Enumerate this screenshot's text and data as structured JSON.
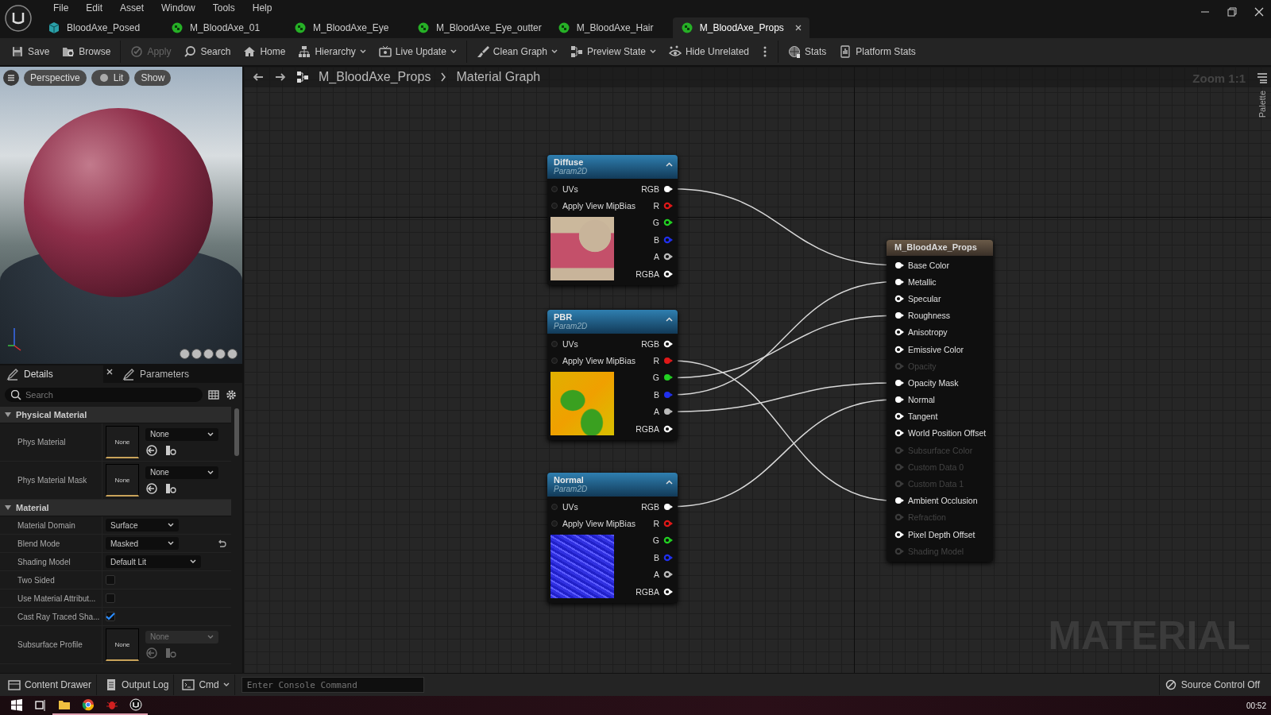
{
  "menu": [
    "File",
    "Edit",
    "Asset",
    "Window",
    "Tools",
    "Help"
  ],
  "tabs": [
    {
      "label": "BloodAxe_Posed",
      "kind": "mesh",
      "selected": false
    },
    {
      "label": "M_BloodAxe_01",
      "kind": "material",
      "selected": false
    },
    {
      "label": "M_BloodAxe_Eye",
      "kind": "material",
      "selected": false
    },
    {
      "label": "M_BloodAxe_Eye_outter",
      "kind": "material",
      "selected": false
    },
    {
      "label": "M_BloodAxe_Hair",
      "kind": "material",
      "selected": false
    },
    {
      "label": "M_BloodAxe_Props",
      "kind": "material",
      "selected": true
    }
  ],
  "toolbar": [
    {
      "label": "Save",
      "disabled": false,
      "dropdown": false,
      "separated": false
    },
    {
      "label": "Browse",
      "disabled": false,
      "dropdown": false,
      "separated": false
    },
    {
      "label": "Apply",
      "disabled": true,
      "dropdown": false,
      "separated": true
    },
    {
      "label": "Search",
      "disabled": false,
      "dropdown": false,
      "separated": false
    },
    {
      "label": "Home",
      "disabled": false,
      "dropdown": false,
      "separated": false
    },
    {
      "label": "Hierarchy",
      "disabled": false,
      "dropdown": true,
      "separated": false
    },
    {
      "label": "Live Update",
      "disabled": false,
      "dropdown": true,
      "separated": false
    },
    {
      "label": "Clean Graph",
      "disabled": false,
      "dropdown": true,
      "separated": true
    },
    {
      "label": "Preview State",
      "disabled": false,
      "dropdown": true,
      "separated": false
    },
    {
      "label": "Hide Unrelated",
      "disabled": false,
      "dropdown": false,
      "separated": false
    },
    {
      "disabled": false,
      "dropdown": false,
      "separated": false
    },
    {
      "label": "Stats",
      "disabled": false,
      "dropdown": false,
      "separated": true
    },
    {
      "label": "Platform Stats",
      "disabled": false,
      "dropdown": false,
      "separated": false
    }
  ],
  "viewport": {
    "buttons": [
      {
        "label": "Perspective",
        "kind": "plain"
      },
      {
        "label": "Lit",
        "kind": "lit"
      },
      {
        "label": "Show",
        "kind": "plain"
      }
    ]
  },
  "details": {
    "tabs": [
      {
        "label": "Details",
        "selected": true
      },
      {
        "label": "Parameters",
        "selected": false
      }
    ],
    "search": {
      "placeholder": "Search"
    },
    "sections": [
      {
        "title": "Physical Material",
        "expanded": true,
        "rows": [
          {
            "label": "Phys Material",
            "kind": "asset",
            "thumb": "None",
            "value": "None",
            "disabled": false
          },
          {
            "label": "Phys Material Mask",
            "kind": "asset",
            "thumb": "None",
            "value": "None",
            "disabled": false
          }
        ]
      },
      {
        "title": "Material",
        "expanded": true,
        "rows": [
          {
            "label": "Material Domain",
            "kind": "dropdown",
            "value": "Surface",
            "reset": false
          },
          {
            "label": "Blend Mode",
            "kind": "dropdown",
            "value": "Masked",
            "reset": true
          },
          {
            "label": "Shading Model",
            "kind": "dropdown",
            "value": "Default Lit",
            "reset": false
          },
          {
            "label": "Two Sided",
            "kind": "checkbox",
            "checked": false
          },
          {
            "label": "Use Material Attribut...",
            "kind": "checkbox",
            "checked": false
          },
          {
            "label": "Cast Ray Traced Sha...",
            "kind": "checkbox",
            "checked": true
          },
          {
            "label": "Subsurface Profile",
            "kind": "asset",
            "thumb": "None",
            "value": "None",
            "disabled": true
          }
        ]
      }
    ]
  },
  "graph": {
    "breadcrumb": [
      "M_BloodAxe_Props",
      "Material Graph"
    ],
    "zoom": "Zoom 1:1",
    "palette": "Palette",
    "watermark": "MATERIAL",
    "nodes": [
      {
        "title": "Diffuse",
        "subtitle": "Param2D",
        "inputs": [
          "UVs",
          "Apply View MipBias"
        ],
        "outputs": [
          {
            "label": "RGB",
            "color": "#ffffff",
            "connected": true
          },
          {
            "label": "R",
            "color": "#e01818",
            "connected": false
          },
          {
            "label": "G",
            "color": "#22d022",
            "connected": false
          },
          {
            "label": "B",
            "color": "#2030ee",
            "connected": false
          },
          {
            "label": "A",
            "color": "#bbbbbb",
            "connected": false
          },
          {
            "label": "RGBA",
            "color": "#ffffff",
            "connected": false
          }
        ]
      },
      {
        "title": "PBR",
        "subtitle": "Param2D",
        "inputs": [
          "UVs",
          "Apply View MipBias"
        ],
        "outputs": [
          {
            "label": "RGB",
            "color": "#ffffff",
            "connected": false
          },
          {
            "label": "R",
            "color": "#e01818",
            "connected": true
          },
          {
            "label": "G",
            "color": "#22d022",
            "connected": true
          },
          {
            "label": "B",
            "color": "#2030ee",
            "connected": true
          },
          {
            "label": "A",
            "color": "#bbbbbb",
            "connected": true
          },
          {
            "label": "RGBA",
            "color": "#ffffff",
            "connected": false
          }
        ]
      },
      {
        "title": "Normal",
        "subtitle": "Param2D",
        "inputs": [
          "UVs",
          "Apply View MipBias"
        ],
        "outputs": [
          {
            "label": "RGB",
            "color": "#ffffff",
            "connected": true
          },
          {
            "label": "R",
            "color": "#e01818",
            "connected": false
          },
          {
            "label": "G",
            "color": "#22d022",
            "connected": false
          },
          {
            "label": "B",
            "color": "#2030ee",
            "connected": false
          },
          {
            "label": "A",
            "color": "#bbbbbb",
            "connected": false
          },
          {
            "label": "RGBA",
            "color": "#ffffff",
            "connected": false
          }
        ]
      }
    ],
    "result": {
      "title": "M_BloodAxe_Props",
      "pins": [
        {
          "label": "Base Color",
          "connected": true,
          "enabled": true
        },
        {
          "label": "Metallic",
          "connected": true,
          "enabled": true
        },
        {
          "label": "Specular",
          "connected": false,
          "enabled": true
        },
        {
          "label": "Roughness",
          "connected": true,
          "enabled": true
        },
        {
          "label": "Anisotropy",
          "connected": false,
          "enabled": true
        },
        {
          "label": "Emissive Color",
          "connected": false,
          "enabled": true
        },
        {
          "label": "Opacity",
          "connected": false,
          "enabled": false
        },
        {
          "label": "Opacity Mask",
          "connected": true,
          "enabled": true
        },
        {
          "label": "Normal",
          "connected": true,
          "enabled": true
        },
        {
          "label": "Tangent",
          "connected": false,
          "enabled": true
        },
        {
          "label": "World Position Offset",
          "connected": false,
          "enabled": true
        },
        {
          "label": "Subsurface Color",
          "connected": false,
          "enabled": false
        },
        {
          "label": "Custom Data 0",
          "connected": false,
          "enabled": false
        },
        {
          "label": "Custom Data 1",
          "connected": false,
          "enabled": false
        },
        {
          "label": "Ambient Occlusion",
          "connected": true,
          "enabled": true
        },
        {
          "label": "Refraction",
          "connected": false,
          "enabled": false
        },
        {
          "label": "Pixel Depth Offset",
          "connected": false,
          "enabled": true
        },
        {
          "label": "Shading Model",
          "connected": false,
          "enabled": false
        }
      ]
    }
  },
  "status_bar": {
    "items": [
      {
        "label": "Content Drawer",
        "dropdown": false
      },
      {
        "label": "Output Log",
        "dropdown": false
      },
      {
        "label": "Cmd",
        "dropdown": true
      }
    ],
    "console": {
      "placeholder": "Enter Console Command"
    },
    "source_control": "Source Control Off"
  },
  "taskbar": {
    "apps": [
      {
        "running": false
      },
      {
        "running": false
      },
      {
        "running": true
      },
      {
        "running": true
      },
      {
        "running": true
      },
      {
        "running": true
      }
    ],
    "clock": "00:52"
  }
}
